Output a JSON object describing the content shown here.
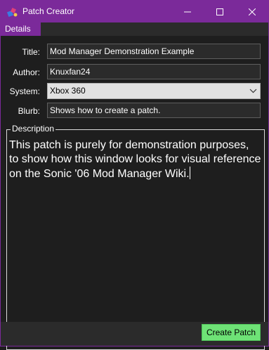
{
  "window": {
    "title": "Patch Creator",
    "accent_color": "#7b2a9a"
  },
  "tabs": [
    {
      "label": "Details",
      "active": true
    }
  ],
  "form": {
    "title_label": "Title:",
    "title_value": "Mod Manager Demonstration Example",
    "author_label": "Author:",
    "author_value": "Knuxfan24",
    "system_label": "System:",
    "system_value": "Xbox 360",
    "blurb_label": "Blurb:",
    "blurb_value": "Shows how to create a patch."
  },
  "description": {
    "legend": "Description",
    "text": "This patch is purely for demonstration purposes, to show how this window looks for visual reference on the Sonic '06 Mod Manager Wiki."
  },
  "footer": {
    "create_button_label": "Create Patch",
    "create_button_color": "#6ee276"
  },
  "icons": {
    "app": "patch-creator-icon",
    "minimize": "minimize-icon",
    "maximize": "maximize-icon",
    "close": "close-icon",
    "dropdown": "chevron-down-icon"
  }
}
